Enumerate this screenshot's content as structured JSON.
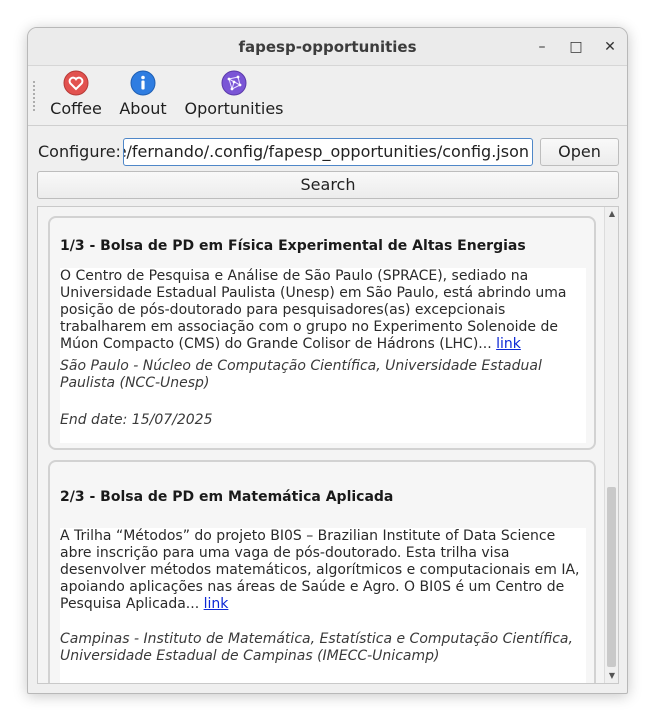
{
  "window": {
    "title": "fapesp-opportunities"
  },
  "controls": {
    "minimize": "–",
    "maximize": "□",
    "close": "✕"
  },
  "toolbar": {
    "items": [
      {
        "label": "Coffee",
        "icon": "heart-icon"
      },
      {
        "label": "About",
        "icon": "info-icon"
      },
      {
        "label": "Oportunities",
        "icon": "network-icon"
      }
    ]
  },
  "config": {
    "label": "Configure:",
    "value": "/home/fernando/.config/fapesp_opportunities/config.json",
    "visible_value": "e/fernando/.config/fapesp_opportunities/config.json",
    "open_label": "Open"
  },
  "search": {
    "label": "Search"
  },
  "opportunities": [
    {
      "title": "1/3 - Bolsa de PD em Física Experimental de Altas Energias",
      "description": "O Centro de Pesquisa e Análise de São Paulo (SPRACE), sediado na Universidade Estadual Paulista (Unesp) em São Paulo, está abrindo uma posição de pós-doutorado para pesquisadores(as) excepcionais trabalharem em associação com o grupo no Experimento Solenoide de Múon Compacto (CMS) do Grande Colisor de Hádrons (LHC)...",
      "link_label": "link",
      "location": "São Paulo - Núcleo de Computação Científica, Universidade Estadual Paulista (NCC-Unesp)",
      "end_date": "End date: 15/07/2025"
    },
    {
      "title": "2/3 - Bolsa de PD em Matemática Aplicada",
      "description": "A Trilha “Métodos” do projeto BI0S – Brazilian Institute of Data Science abre inscrição para uma vaga de pós-doutorado. Esta trilha visa desenvolver métodos matemáticos, algorítmicos e computacionais em IA, apoiando aplicações nas áreas de Saúde e Agro. O BI0S é um Centro de Pesquisa Aplicada...",
      "link_label": "link",
      "location": "Campinas - Instituto de Matemática, Estatística e Computação Científica, Universidade Estadual de Campinas (IMECC-Unicamp)"
    }
  ],
  "colors": {
    "link": "#0b27d6",
    "input_border": "#4f87c8",
    "heart": "#e2524f",
    "info": "#2f7de1",
    "network": "#7a55d6"
  }
}
